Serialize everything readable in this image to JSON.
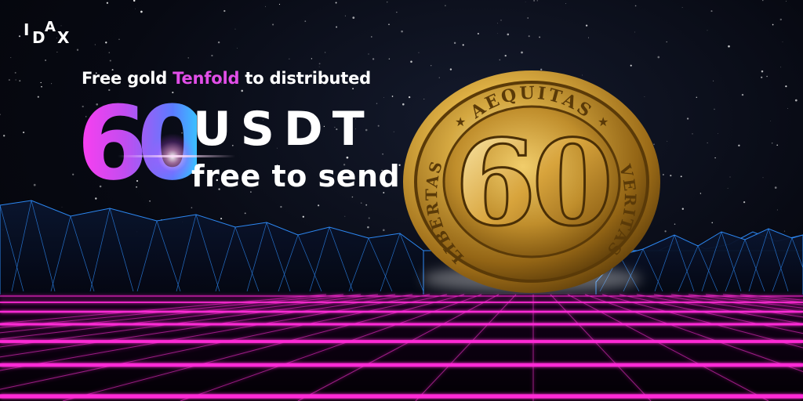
{
  "logo": {
    "letters": [
      "I",
      "D",
      "A",
      "X"
    ]
  },
  "headline": {
    "pre": "Free gold ",
    "highlight": "Tenfold",
    "post": " to distributed"
  },
  "offer": {
    "amount": "60",
    "currency": "USDT",
    "tagline": "free to send"
  },
  "coin": {
    "value": "60",
    "top_inscription": "AEQUITAS",
    "left_inscription": "LIBERTAS",
    "right_inscription": "VERITAS"
  },
  "colors": {
    "highlight": "#e24ee8",
    "grid_magenta": "#ff2bd6",
    "mountain_blue": "#2f8fff",
    "gold": "#d4a437",
    "background": "#05060d"
  }
}
